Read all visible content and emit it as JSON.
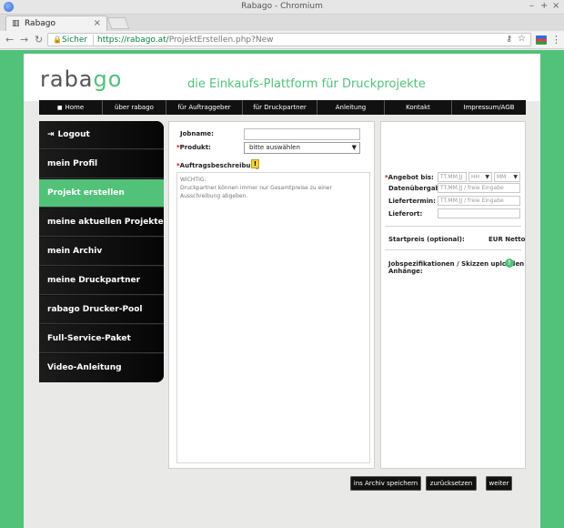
{
  "window": {
    "title": "Rabago - Chromium"
  },
  "tab": {
    "title": "Rabago"
  },
  "address": {
    "secure_label": "Sicher",
    "url_host": "https://rabago.at/",
    "url_path": "ProjektErstellen.php?New"
  },
  "site": {
    "brand_prefix": "raba",
    "brand_accent": "go",
    "tagline": "die Einkaufs-Plattform für Druckprojekte",
    "colors": {
      "accent": "#52c17a",
      "dark": "#111111"
    }
  },
  "nav": {
    "items": [
      "Home",
      "über rabago",
      "für Auftraggeber",
      "für Druckpartner",
      "Anleitung",
      "Kontakt",
      "Impressum/AGB"
    ]
  },
  "sidebar": {
    "items": [
      {
        "label": "Logout",
        "icon": "logout-icon"
      },
      {
        "label": "mein Profil"
      },
      {
        "label": "Projekt erstellen",
        "active": true
      },
      {
        "label": "meine aktuellen Projekte"
      },
      {
        "label": "mein Archiv"
      },
      {
        "label": "meine Druckpartner"
      },
      {
        "label": "rabago Drucker-Pool"
      },
      {
        "label": "Full-Service-Paket"
      },
      {
        "label": "Video-Anleitung"
      }
    ]
  },
  "form": {
    "jobname_label": "Jobname:",
    "jobname_value": "",
    "product_label": "Produkt:",
    "product_value": "bitte auswählen",
    "description_label": "Auftragsbeschreibung",
    "help_icon_glyph": "!",
    "description_hint_title": "WICHTIG:",
    "description_hint_text": "Druckpartner können immer nur Gesamtpreise zu einer Ausschreibung abgeben."
  },
  "right": {
    "angebot_label": "Angebot bis:",
    "angebot_date_placeholder": "TT.MM.JJ",
    "angebot_hour": "HH",
    "angebot_minute": "MM",
    "datenuebergabe_label": "Datenübergabe:",
    "datenuebergabe_placeholder": "TT.MM.JJ / freie Eingabe",
    "liefertermin_label": "Liefertermin:",
    "liefertermin_placeholder": "TT.MM.JJ / freie Eingabe",
    "lieferort_label": "Lieferort:",
    "lieferort_value": "",
    "startpreis_label": "Startpreis (optional):",
    "startpreis_unit": "EUR Netto",
    "upload_label": "Jobspezifikationen / Skizzen uploaden",
    "anhaenge_label": "Anhänge:"
  },
  "buttons": {
    "archive": "ins Archiv speichern",
    "reset": "zurücksetzen",
    "next": "weiter"
  }
}
